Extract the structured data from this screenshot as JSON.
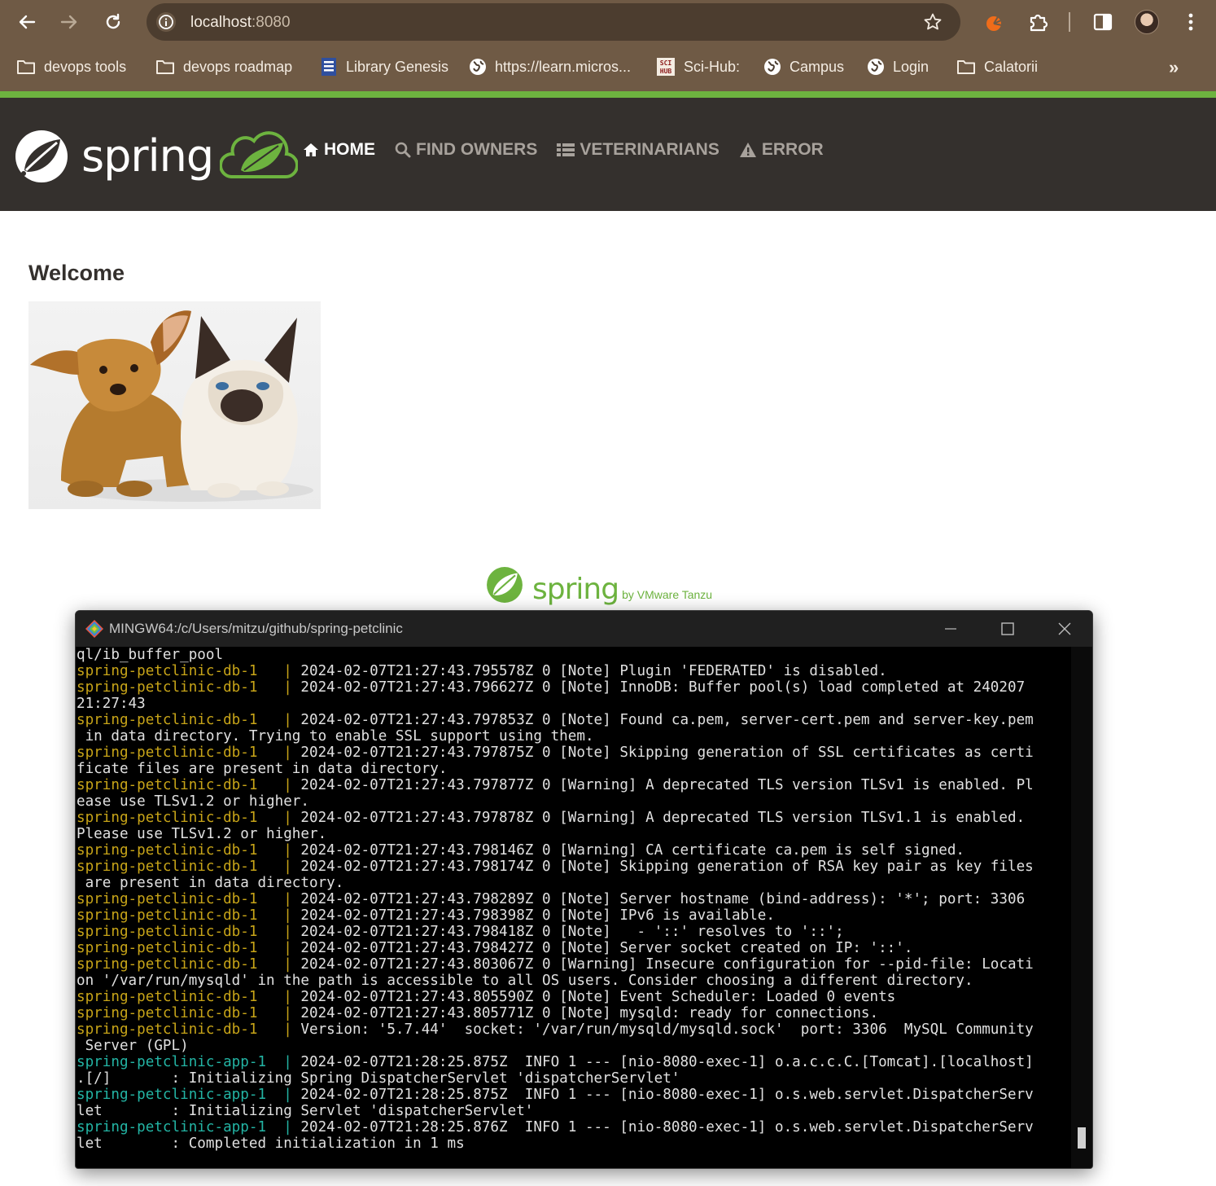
{
  "browser": {
    "url_host": "localhost",
    "url_port": ":8080",
    "bookmarks": [
      {
        "label": "devops tools",
        "icon": "folder-icon"
      },
      {
        "label": "devops roadmap",
        "icon": "folder-icon"
      },
      {
        "label": "Library Genesis",
        "icon": "library-genesis-icon"
      },
      {
        "label": "https://learn.micros...",
        "icon": "globe-icon"
      },
      {
        "label": "Sci-Hub:",
        "icon": "scihub-icon"
      },
      {
        "label": "Campus",
        "icon": "globe-icon"
      },
      {
        "label": "Login",
        "icon": "globe-icon"
      },
      {
        "label": "Calatorii",
        "icon": "folder-icon"
      }
    ],
    "more_label": "»"
  },
  "page": {
    "brand_word": "spring",
    "nav": [
      {
        "label": "Home",
        "icon": "home-icon",
        "active": true
      },
      {
        "label": "Find owners",
        "icon": "search-icon",
        "active": false
      },
      {
        "label": "Veterinarians",
        "icon": "list-icon",
        "active": false
      },
      {
        "label": "Error",
        "icon": "warning-icon",
        "active": false
      }
    ],
    "heading": "Welcome",
    "footer_word": "spring",
    "footer_by": "by VMware Tanzu"
  },
  "terminal": {
    "title": "MINGW64:/c/Users/mitzu/github/spring-petclinic",
    "lines": [
      {
        "tag": "",
        "text": "ql/ib_buffer_pool"
      },
      {
        "tag": "db",
        "text": "spring-petclinic-db-1   | 2024-02-07T21:27:43.795578Z 0 [Note] Plugin 'FEDERATED' is disabled."
      },
      {
        "tag": "db",
        "text": "spring-petclinic-db-1   | 2024-02-07T21:27:43.796627Z 0 [Note] InnoDB: Buffer pool(s) load completed at 240207"
      },
      {
        "tag": "",
        "text": "21:27:43"
      },
      {
        "tag": "db",
        "text": "spring-petclinic-db-1   | 2024-02-07T21:27:43.797853Z 0 [Note] Found ca.pem, server-cert.pem and server-key.pem"
      },
      {
        "tag": "",
        "text": " in data directory. Trying to enable SSL support using them."
      },
      {
        "tag": "db",
        "text": "spring-petclinic-db-1   | 2024-02-07T21:27:43.797875Z 0 [Note] Skipping generation of SSL certificates as certi"
      },
      {
        "tag": "",
        "text": "ficate files are present in data directory."
      },
      {
        "tag": "db",
        "text": "spring-petclinic-db-1   | 2024-02-07T21:27:43.797877Z 0 [Warning] A deprecated TLS version TLSv1 is enabled. Pl"
      },
      {
        "tag": "",
        "text": "ease use TLSv1.2 or higher."
      },
      {
        "tag": "db",
        "text": "spring-petclinic-db-1   | 2024-02-07T21:27:43.797878Z 0 [Warning] A deprecated TLS version TLSv1.1 is enabled."
      },
      {
        "tag": "",
        "text": "Please use TLSv1.2 or higher."
      },
      {
        "tag": "db",
        "text": "spring-petclinic-db-1   | 2024-02-07T21:27:43.798146Z 0 [Warning] CA certificate ca.pem is self signed."
      },
      {
        "tag": "db",
        "text": "spring-petclinic-db-1   | 2024-02-07T21:27:43.798174Z 0 [Note] Skipping generation of RSA key pair as key files"
      },
      {
        "tag": "",
        "text": " are present in data directory."
      },
      {
        "tag": "db",
        "text": "spring-petclinic-db-1   | 2024-02-07T21:27:43.798289Z 0 [Note] Server hostname (bind-address): '*'; port: 3306"
      },
      {
        "tag": "db",
        "text": "spring-petclinic-db-1   | 2024-02-07T21:27:43.798398Z 0 [Note] IPv6 is available."
      },
      {
        "tag": "db",
        "text": "spring-petclinic-db-1   | 2024-02-07T21:27:43.798418Z 0 [Note]   - '::' resolves to '::';"
      },
      {
        "tag": "db",
        "text": "spring-petclinic-db-1   | 2024-02-07T21:27:43.798427Z 0 [Note] Server socket created on IP: '::'."
      },
      {
        "tag": "db",
        "text": "spring-petclinic-db-1   | 2024-02-07T21:27:43.803067Z 0 [Warning] Insecure configuration for --pid-file: Locati"
      },
      {
        "tag": "",
        "text": "on '/var/run/mysqld' in the path is accessible to all OS users. Consider choosing a different directory."
      },
      {
        "tag": "db",
        "text": "spring-petclinic-db-1   | 2024-02-07T21:27:43.805590Z 0 [Note] Event Scheduler: Loaded 0 events"
      },
      {
        "tag": "db",
        "text": "spring-petclinic-db-1   | 2024-02-07T21:27:43.805771Z 0 [Note] mysqld: ready for connections."
      },
      {
        "tag": "db",
        "text": "spring-petclinic-db-1   | Version: '5.7.44'  socket: '/var/run/mysqld/mysqld.sock'  port: 3306  MySQL Community"
      },
      {
        "tag": "",
        "text": " Server (GPL)"
      },
      {
        "tag": "app",
        "text": "spring-petclinic-app-1  | 2024-02-07T21:28:25.875Z  INFO 1 --- [nio-8080-exec-1] o.a.c.c.C.[Tomcat].[localhost]"
      },
      {
        "tag": "",
        "text": ".[/]       : Initializing Spring DispatcherServlet 'dispatcherServlet'"
      },
      {
        "tag": "app",
        "text": "spring-petclinic-app-1  | 2024-02-07T21:28:25.875Z  INFO 1 --- [nio-8080-exec-1] o.s.web.servlet.DispatcherServ"
      },
      {
        "tag": "",
        "text": "let        : Initializing Servlet 'dispatcherServlet'"
      },
      {
        "tag": "app",
        "text": "spring-petclinic-app-1  | 2024-02-07T21:28:25.876Z  INFO 1 --- [nio-8080-exec-1] o.s.web.servlet.DispatcherServ"
      },
      {
        "tag": "",
        "text": "let        : Completed initialization in 1 ms"
      }
    ]
  },
  "colors": {
    "chrome_bg": "#6f5a45",
    "spring_green": "#6db33f",
    "navbar_bg": "#34302d",
    "term_db_prefix": "#c7a418",
    "term_app_prefix": "#23b4a4"
  }
}
